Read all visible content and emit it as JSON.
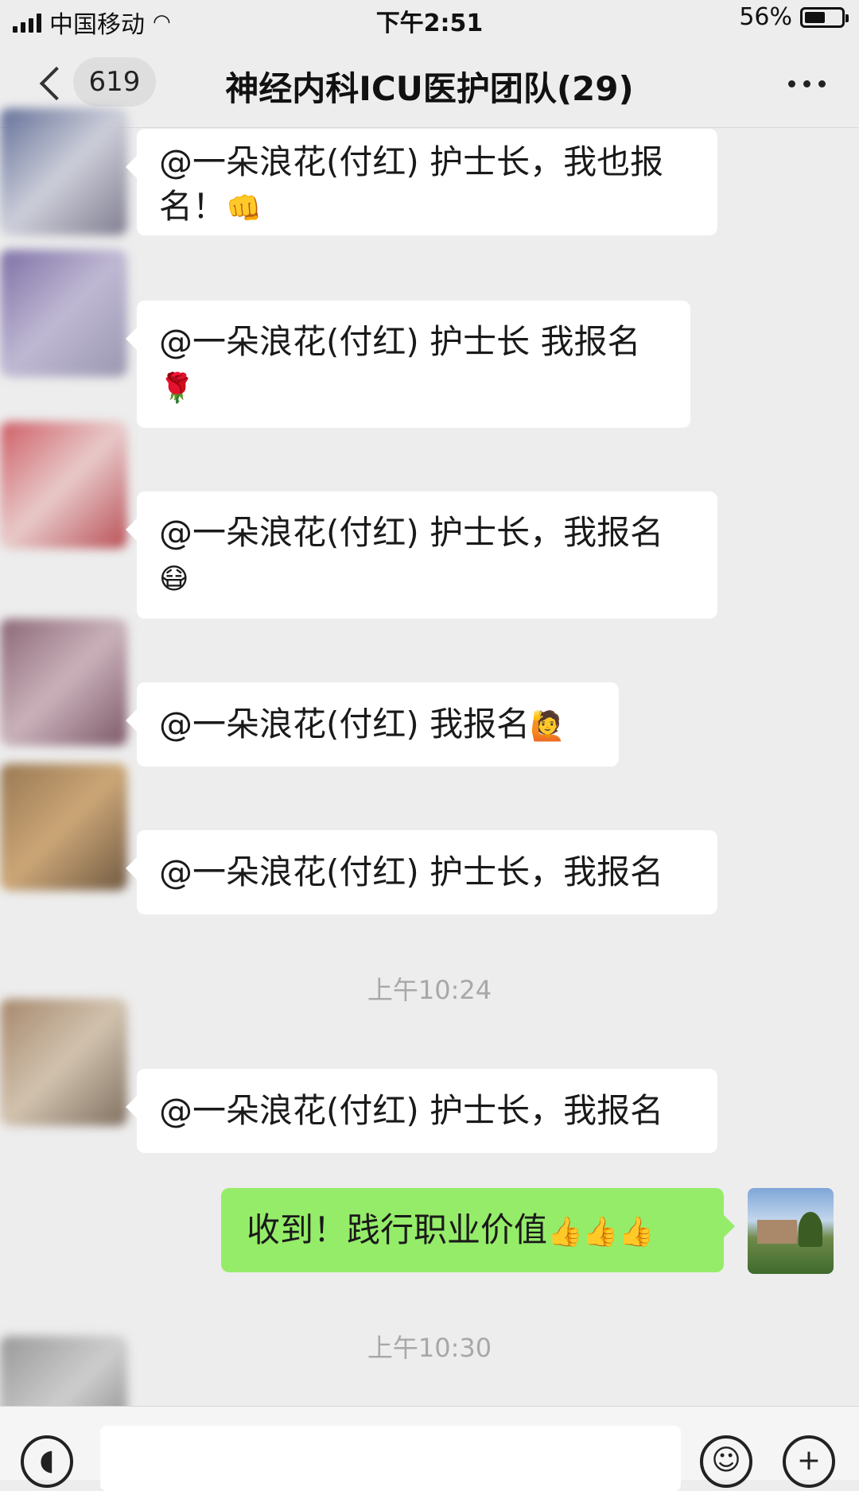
{
  "status_bar": {
    "carrier": "中国移动",
    "time": "下午2:51",
    "battery": "56%",
    "battery_level": 0.56
  },
  "header": {
    "back_badge": "619",
    "title": "神经内科ICU医护团队(29)"
  },
  "messages": [
    {
      "text": "@一朵浪花(付红) 护士长，我也报",
      "text2": "名！",
      "emoji": "👊"
    },
    {
      "text": "@一朵浪花(付红) 护士长 我报名",
      "emoji": "🌹"
    },
    {
      "text": "@一朵浪花(付红) 护士长，我报名",
      "emoji": "😷"
    },
    {
      "text": "@一朵浪花(付红) 我报名",
      "emoji": "🙋"
    },
    {
      "text": "@一朵浪花(付红) 护士长，我报名"
    },
    {
      "text": "@一朵浪花(付红) 护士长，我报名"
    }
  ],
  "timestamps": [
    "上午10:24",
    "上午10:30"
  ],
  "my_message": {
    "text": "收到！践行职业价值",
    "emoji": "👍👍👍"
  },
  "input": {
    "placeholder": ""
  },
  "colors": {
    "background": "#ededed",
    "bubble_in": "#ffffff",
    "bubble_out": "#95ec69"
  }
}
